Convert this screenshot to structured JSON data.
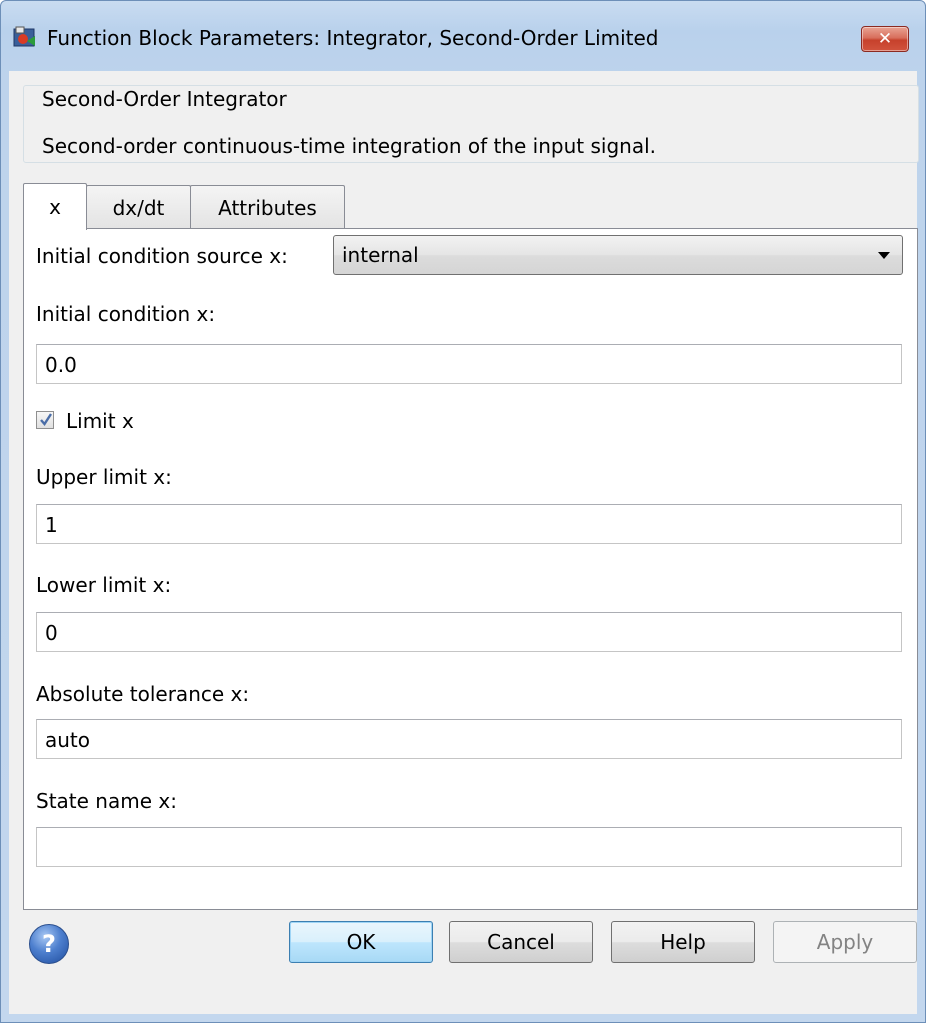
{
  "window": {
    "title": "Function Block Parameters: Integrator, Second-Order Limited",
    "close_label": "✕"
  },
  "group": {
    "title": "Second-Order Integrator",
    "description": "Second-order continuous-time integration of the input signal."
  },
  "tabs": [
    {
      "label": "x",
      "active": true
    },
    {
      "label": "dx/dt",
      "active": false
    },
    {
      "label": "Attributes",
      "active": false
    }
  ],
  "params": {
    "ic_source_label": "Initial condition source x:",
    "ic_source_value": "internal",
    "ic_label": "Initial condition x:",
    "ic_value": "0.0",
    "limit_label": "Limit x",
    "limit_checked": true,
    "upper_label": "Upper limit x:",
    "upper_value": "1",
    "lower_label": "Lower limit x:",
    "lower_value": "0",
    "abstol_label": "Absolute tolerance x:",
    "abstol_value": "auto",
    "state_label": "State name x:",
    "state_value": ""
  },
  "buttons": {
    "help_icon": "?",
    "ok": "OK",
    "cancel": "Cancel",
    "help": "Help",
    "apply": "Apply"
  },
  "colors": {
    "titlebar": "#bdd3ec",
    "client_bg": "#f0f0f0",
    "close_button": "#c6412c",
    "default_button_border": "#3c7fb1"
  }
}
